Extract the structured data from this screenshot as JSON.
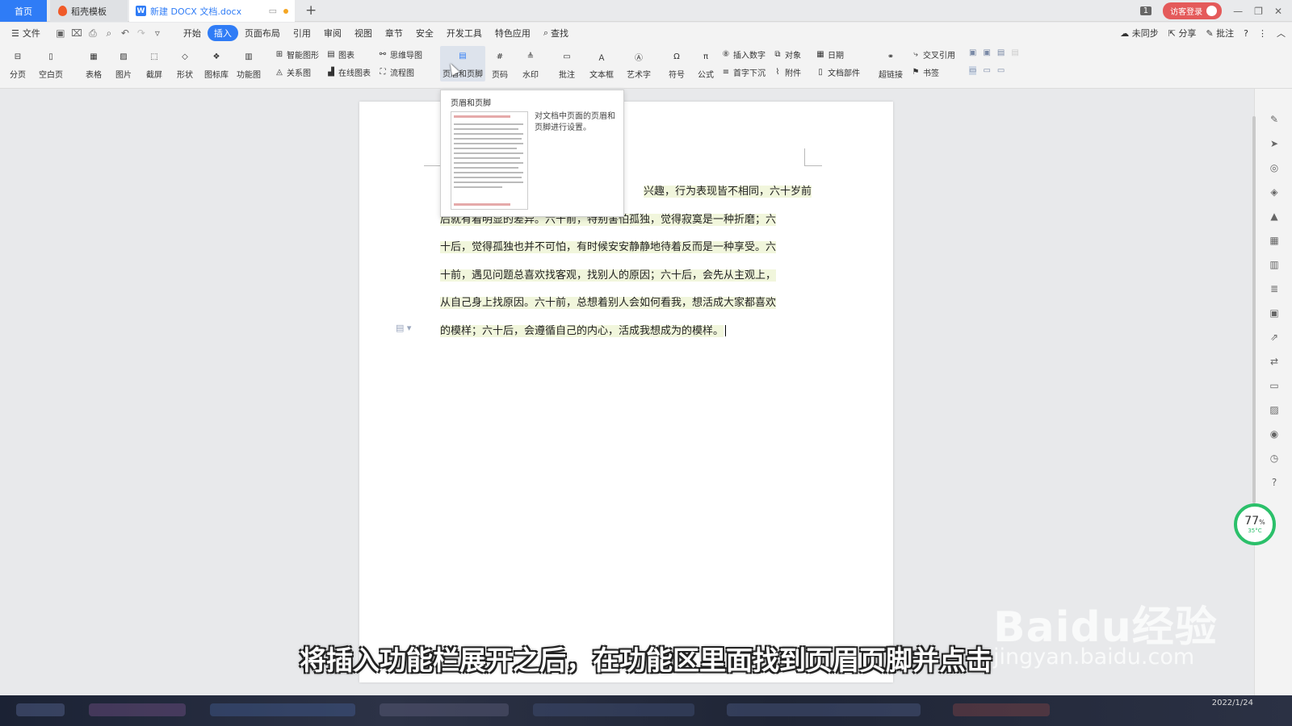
{
  "tabs": {
    "home": "首页",
    "daoke": "稻壳模板",
    "doc": "新建 DOCX 文档.docx",
    "count_badge": "1",
    "login": "访客登录"
  },
  "menu": {
    "file": "文件",
    "items": [
      "开始",
      "插入",
      "页面布局",
      "引用",
      "审阅",
      "视图",
      "章节",
      "安全",
      "开发工具",
      "特色应用"
    ],
    "search": "查找",
    "right": [
      "未同步",
      "分享",
      "批注",
      "?"
    ]
  },
  "ribbon": {
    "large": [
      "分页",
      "空白页",
      "表格",
      "图片",
      "截屏",
      "形状",
      "图标库",
      "功能图",
      "页眉和页脚",
      "页码",
      "水印",
      "批注",
      "文本框",
      "艺术字",
      "符号",
      "公式",
      "超链接"
    ],
    "small": [
      "智能图形",
      "图表",
      "思维导图",
      "关系图",
      "在线图表",
      "流程图",
      "插入数字",
      "对象",
      "日期",
      "首字下沉",
      "附件",
      "文档部件",
      "交叉引用",
      "书签"
    ]
  },
  "tooltip": {
    "title": "页眉和页脚",
    "desc": "对文档中页面的页眉和页脚进行设置。"
  },
  "document": {
    "lines": [
      "兴趣，行为表现皆不相同，六十岁前",
      "后就有着明显的差异。六十前，特别害怕孤独，觉得寂寞是一种折磨；六",
      "十后，觉得孤独也并不可怕，有时候安安静静地待着反而是一种享受。六",
      "十前，遇见问题总喜欢找客观，找别人的原因；六十后，会先从主观上，",
      "从自己身上找原因。六十前，总想着别人会如何看我，想活成大家都喜欢",
      "的模样；六十后，会遵循自己的内心，活成我想成为的模样。"
    ]
  },
  "perf": {
    "percent": "77",
    "percent_unit": "%",
    "temp": "35°C"
  },
  "subtitle": "将插入功能栏展开之后，在功能区里面找到页眉页脚并点击",
  "watermark": {
    "brand": "Baidu经验",
    "url": "jingyan.baidu.com"
  },
  "clock": "2022/1/24",
  "colors": {
    "accent": "#2f7cf6",
    "highlight": "#f1f6dc",
    "perf_ring": "#2bc06a",
    "login": "#e45a5a"
  }
}
